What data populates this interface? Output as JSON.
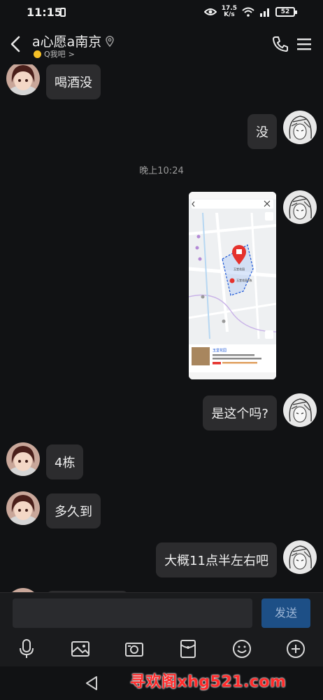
{
  "status": {
    "time": "11:15",
    "speed_top": "17.5",
    "speed_bottom": "K/s",
    "battery": "52"
  },
  "header": {
    "title": "a心愿a南京",
    "subtitle": "Q我吧",
    "subtitle_chevron": ">"
  },
  "messages": [
    {
      "side": "left",
      "text": "喝酒没"
    },
    {
      "side": "right",
      "text": "没"
    },
    {
      "type": "time",
      "text": "晚上10:24"
    },
    {
      "side": "right",
      "type": "image"
    },
    {
      "side": "right",
      "text": "是这个吗?"
    },
    {
      "side": "left",
      "text": "4栋"
    },
    {
      "side": "left",
      "text": "多久到"
    },
    {
      "side": "right",
      "text": "大概11点半左右吧"
    }
  ],
  "map_card": {
    "search_text": "江宁玉堂花园",
    "place_name": "玉堂花园",
    "pin_label": "玉堂花园",
    "pin2_label": "玉堂花园4栋"
  },
  "input": {
    "placeholder": "",
    "send_label": "发送"
  },
  "toolbar": [
    "mic-icon",
    "image-icon",
    "camera-icon",
    "red-packet-icon",
    "emoji-icon",
    "plus-icon"
  ],
  "watermark": "寻欢阁xhg521.com",
  "colors": {
    "bg": "#111214",
    "bubble": "#2c2c2e",
    "send": "#1d4f86",
    "watermark": "#ff2a2a"
  }
}
